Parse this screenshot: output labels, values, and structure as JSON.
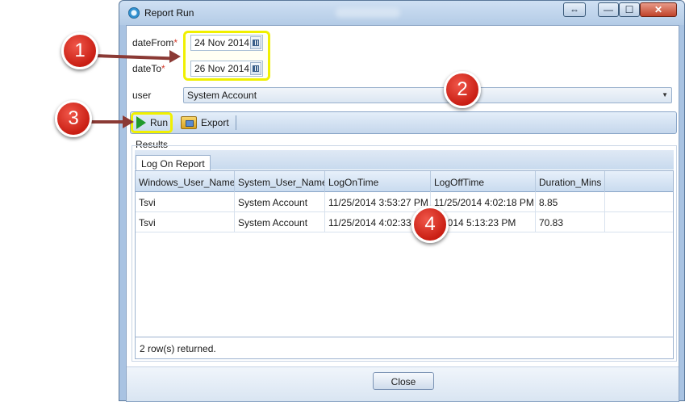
{
  "window": {
    "title": "Report Run",
    "controls": {
      "move": "⇔",
      "minimize": "—",
      "maximize": "☐",
      "close": "✕"
    }
  },
  "form": {
    "date_from": {
      "label": "dateFrom",
      "required_mark": "*",
      "value": "24 Nov 2014"
    },
    "date_to": {
      "label": "dateTo",
      "required_mark": "*",
      "value": "26 Nov 2014"
    },
    "user": {
      "label": "user",
      "value": "System Account"
    }
  },
  "toolbar": {
    "run_label": "Run",
    "export_label": "Export"
  },
  "results": {
    "group_label": "Results",
    "tab_label": "Log On Report",
    "columns": [
      "Windows_User_Name",
      "System_User_Name",
      "LogOnTime",
      "LogOffTime",
      "Duration_Mins"
    ],
    "rows": [
      [
        "Tsvi",
        "System Account",
        "11/25/2014 3:53:27 PM",
        "11/25/2014 4:02:18 PM",
        "8.85"
      ],
      [
        "Tsvi",
        "System Account",
        "11/25/2014 4:02:33",
        "5/2014 5:13:23 PM",
        "70.83"
      ]
    ],
    "status": "2 row(s) returned."
  },
  "footer": {
    "close_label": "Close"
  },
  "callouts": [
    "1",
    "2",
    "3",
    "4"
  ],
  "colors": {
    "highlight": "#f0f000",
    "callout": "#d4261a",
    "arrow": "#8b3a35"
  }
}
